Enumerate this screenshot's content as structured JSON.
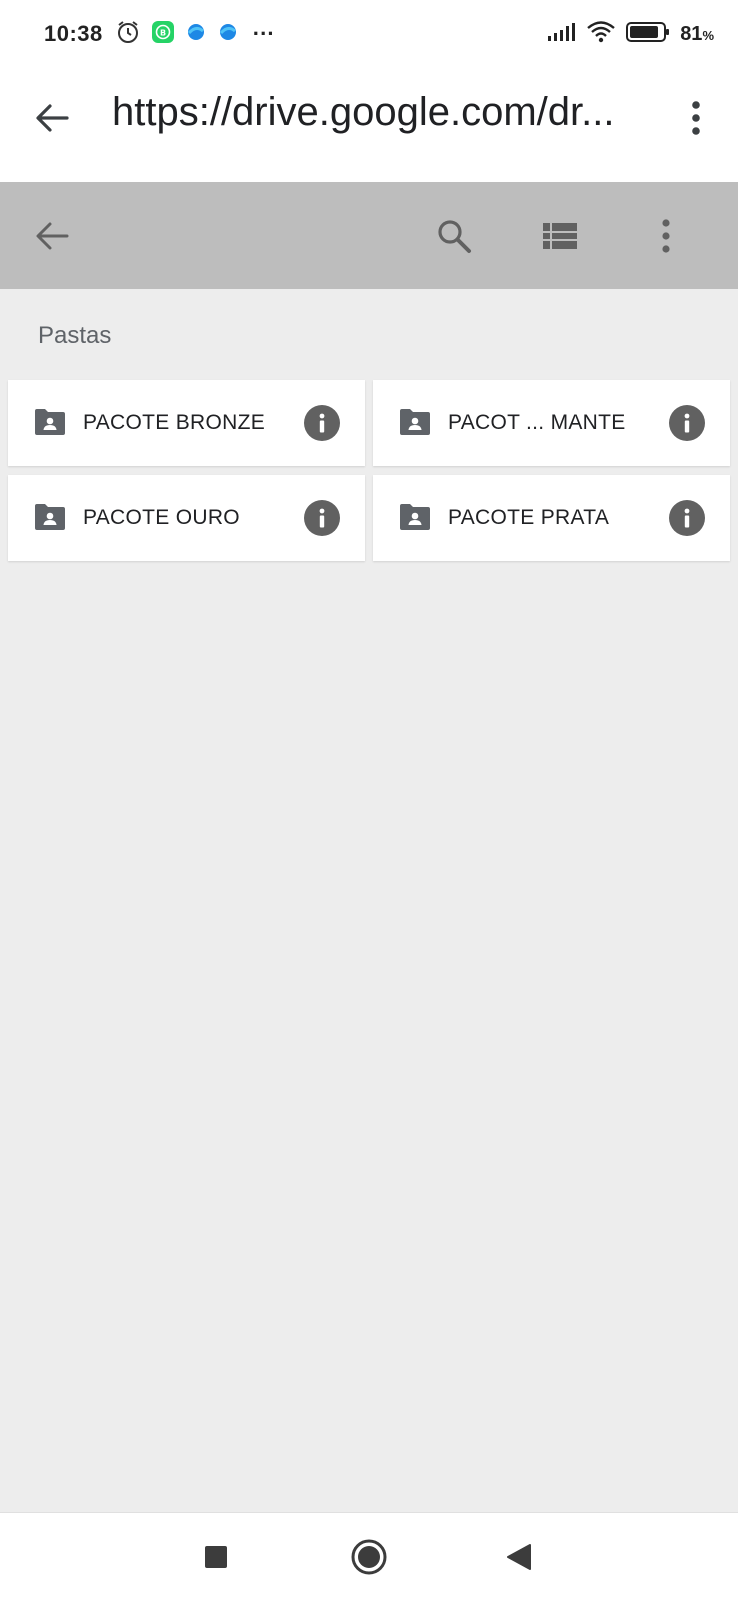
{
  "status_bar": {
    "time": "10:38",
    "more_indicator": "···",
    "battery_percent": "81",
    "battery_unit": "%",
    "icons_left": [
      "alarm-icon",
      "whatsapp-business-icon",
      "app-notification-icon",
      "app-notification-icon"
    ],
    "icons_right": [
      "signal-icon",
      "wifi-icon",
      "battery-icon"
    ]
  },
  "browser": {
    "url": "https://drive.google.com/dr...",
    "back_icon": "arrow-back-icon",
    "menu_icon": "more-vert-icon"
  },
  "toolbar": {
    "back_icon": "arrow-back-icon",
    "search_icon": "search-icon",
    "view_icon": "list-view-icon",
    "menu_icon": "more-vert-icon",
    "background": "#bdbdbd"
  },
  "section": {
    "title": "Pastas"
  },
  "folders": [
    {
      "name": "PACOTE BRONZE",
      "icon": "shared-folder-icon"
    },
    {
      "name": "PACOT ... MANTE",
      "icon": "shared-folder-icon"
    },
    {
      "name": "PACOTE OURO",
      "icon": "shared-folder-icon"
    },
    {
      "name": "PACOTE PRATA",
      "icon": "shared-folder-icon"
    }
  ],
  "nav_bar": {
    "buttons": [
      "recents-square-icon",
      "home-circle-icon",
      "back-triangle-icon"
    ]
  },
  "colors": {
    "page_background": "#ededed",
    "card_background": "#ffffff",
    "icon_gray": "#616161",
    "whatsapp_green": "#25d366"
  }
}
